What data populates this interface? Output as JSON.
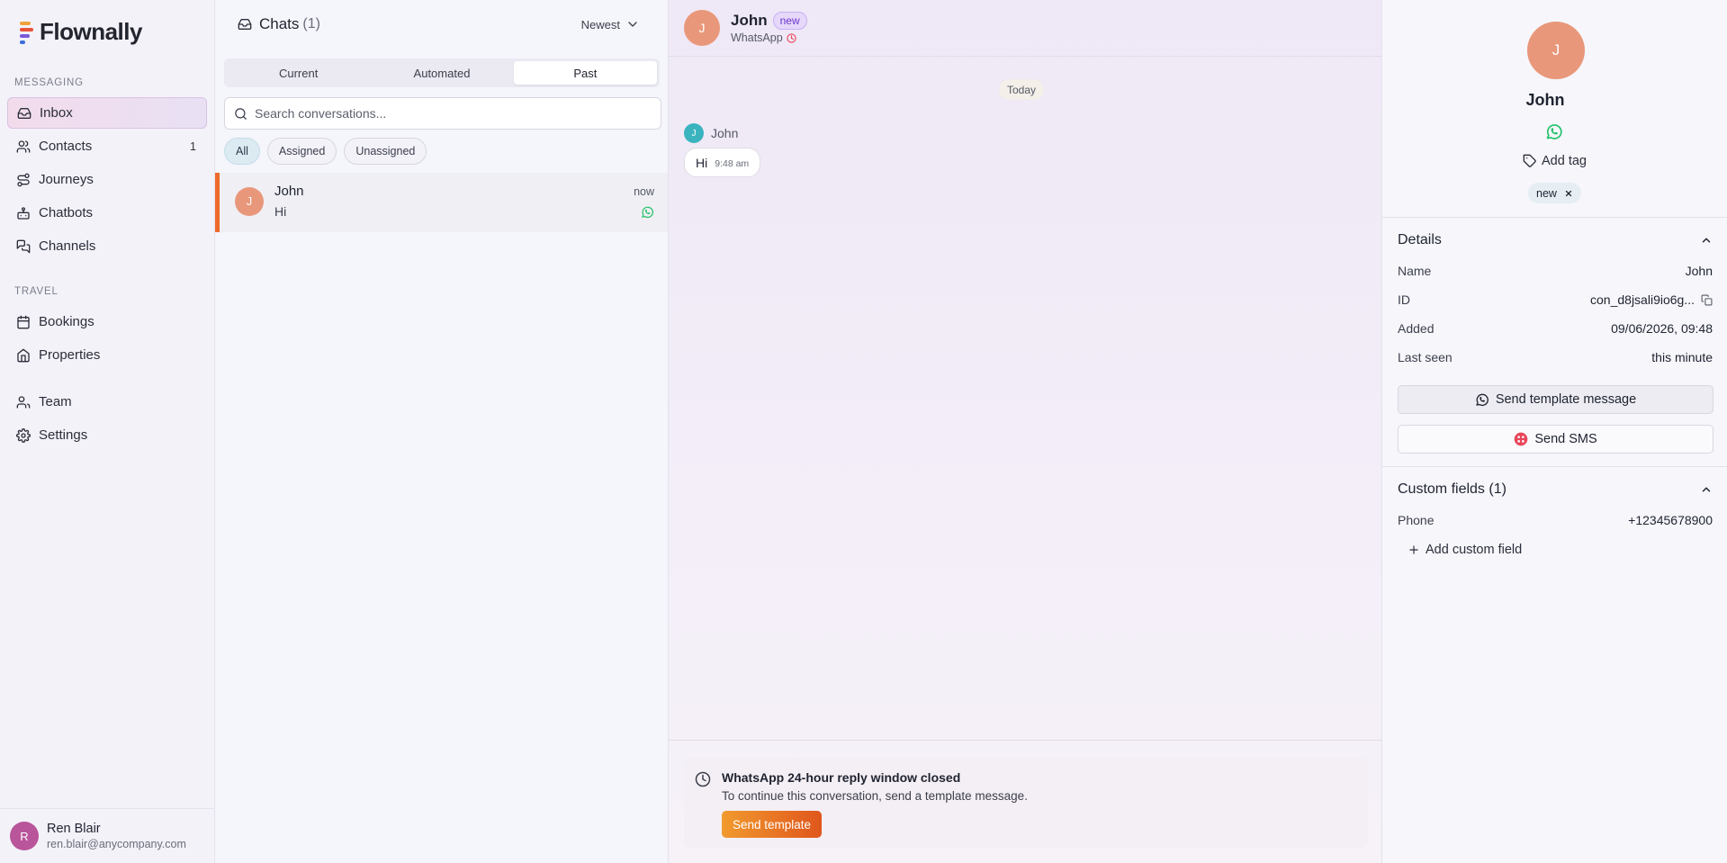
{
  "app": {
    "name": "Flownally"
  },
  "sidebar": {
    "sections": {
      "messaging": "MESSAGING",
      "travel": "TRAVEL"
    },
    "items": [
      {
        "label": "Inbox",
        "icon": "inbox-icon",
        "active": true
      },
      {
        "label": "Contacts",
        "icon": "users-icon",
        "count": "1"
      },
      {
        "label": "Journeys",
        "icon": "route-icon"
      },
      {
        "label": "Chatbots",
        "icon": "bot-icon"
      },
      {
        "label": "Channels",
        "icon": "chat-bubbles-icon"
      },
      {
        "label": "Bookings",
        "icon": "calendar-icon"
      },
      {
        "label": "Properties",
        "icon": "home-icon"
      },
      {
        "label": "Team",
        "icon": "team-icon"
      },
      {
        "label": "Settings",
        "icon": "gear-icon"
      }
    ],
    "user": {
      "initial": "R",
      "name": "Ren Blair",
      "email": "ren.blair@anycompany.com"
    }
  },
  "chat_list": {
    "title": "Chats",
    "count": "(1)",
    "sort": "Newest",
    "tabs": [
      {
        "label": "Current"
      },
      {
        "label": "Automated"
      },
      {
        "label": "Past",
        "active": true
      }
    ],
    "search_placeholder": "Search conversations...",
    "filters": [
      {
        "label": "All",
        "active": true
      },
      {
        "label": "Assigned"
      },
      {
        "label": "Unassigned"
      }
    ],
    "conversations": [
      {
        "initial": "J",
        "name": "John",
        "time": "now",
        "preview": "Hi",
        "channel": "whatsapp-icon"
      }
    ]
  },
  "chat": {
    "initial": "J",
    "name": "John",
    "badge": "new",
    "channel": "WhatsApp",
    "day": "Today",
    "messages": [
      {
        "author_initial": "J",
        "author": "John",
        "text": "Hi",
        "time": "9:48 am"
      }
    ],
    "notice": {
      "title": "WhatsApp 24-hour reply window closed",
      "text": "To continue this conversation, send a template message.",
      "button": "Send template"
    }
  },
  "contact": {
    "initial": "J",
    "name": "John",
    "add_tag": "Add tag",
    "tag": "new",
    "details": {
      "title": "Details",
      "rows": [
        {
          "key": "Name",
          "value": "John"
        },
        {
          "key": "ID",
          "value": "con_d8jsali9io6g..."
        },
        {
          "key": "Added",
          "value": "09/06/2026, 09:48"
        },
        {
          "key": "Last seen",
          "value": "this minute"
        }
      ],
      "send_template": "Send template message",
      "send_sms": "Send SMS"
    },
    "custom_fields": {
      "title": "Custom fields (1)",
      "rows": [
        {
          "key": "Phone",
          "value": "+12345678900"
        }
      ],
      "add": "Add custom field"
    }
  },
  "colors": {
    "accent": "#ee6a2c",
    "whatsapp": "#25c26a",
    "badge": "#6b36c9",
    "avatar": "#e9977a"
  }
}
